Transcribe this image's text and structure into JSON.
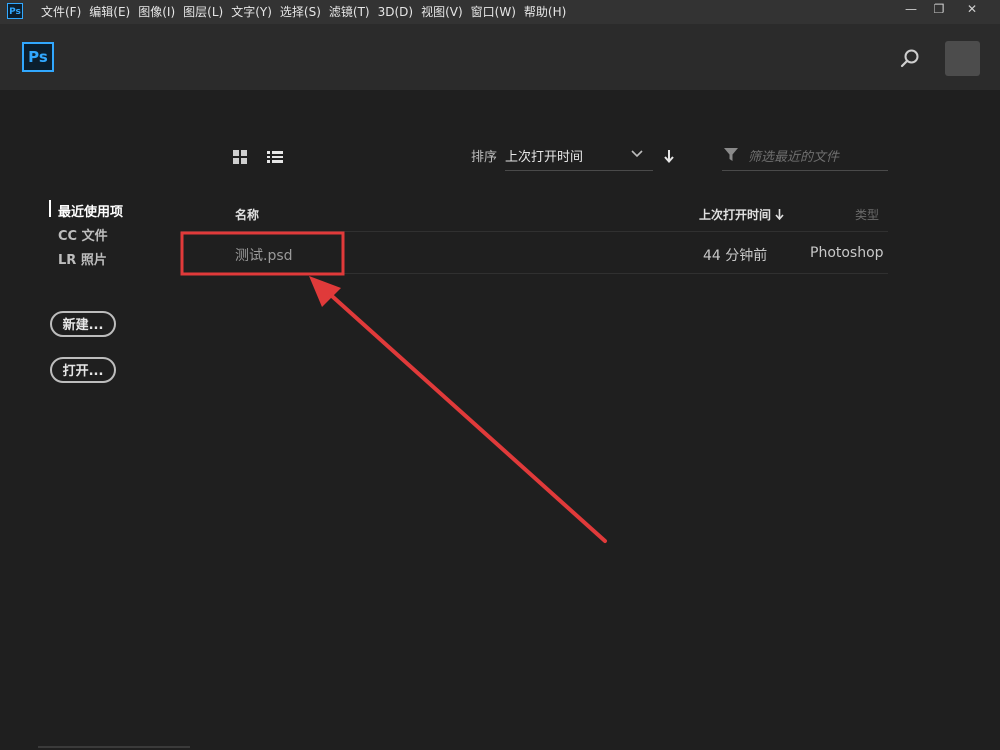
{
  "app": {
    "badge": "Ps"
  },
  "menu": [
    "文件(F)",
    "编辑(E)",
    "图像(I)",
    "图层(L)",
    "文字(Y)",
    "选择(S)",
    "滤镜(T)",
    "3D(D)",
    "视图(V)",
    "窗口(W)",
    "帮助(H)"
  ],
  "window_controls": {
    "minimize": "—",
    "restore": "❐",
    "close": "✕"
  },
  "header": {
    "logo": "Ps"
  },
  "sidebar": {
    "items": [
      {
        "label": "最近使用项",
        "active": true
      },
      {
        "label": "CC 文件",
        "active": false
      },
      {
        "label": "LR 照片",
        "active": false
      }
    ],
    "new_button": "新建...",
    "open_button": "打开..."
  },
  "toolbar": {
    "sort_label": "排序",
    "sort_value": "上次打开时间",
    "filter_placeholder": "筛选最近的文件"
  },
  "table": {
    "columns": {
      "name": "名称",
      "last_opened": "上次打开时间",
      "type": "类型"
    },
    "rows": [
      {
        "name": "测试.psd",
        "last_opened": "44 分钟前",
        "type": "Photoshop"
      }
    ]
  },
  "colors": {
    "accent": "#31a8ff",
    "annotation": "#e03a3a",
    "background": "#1f1f1f"
  }
}
